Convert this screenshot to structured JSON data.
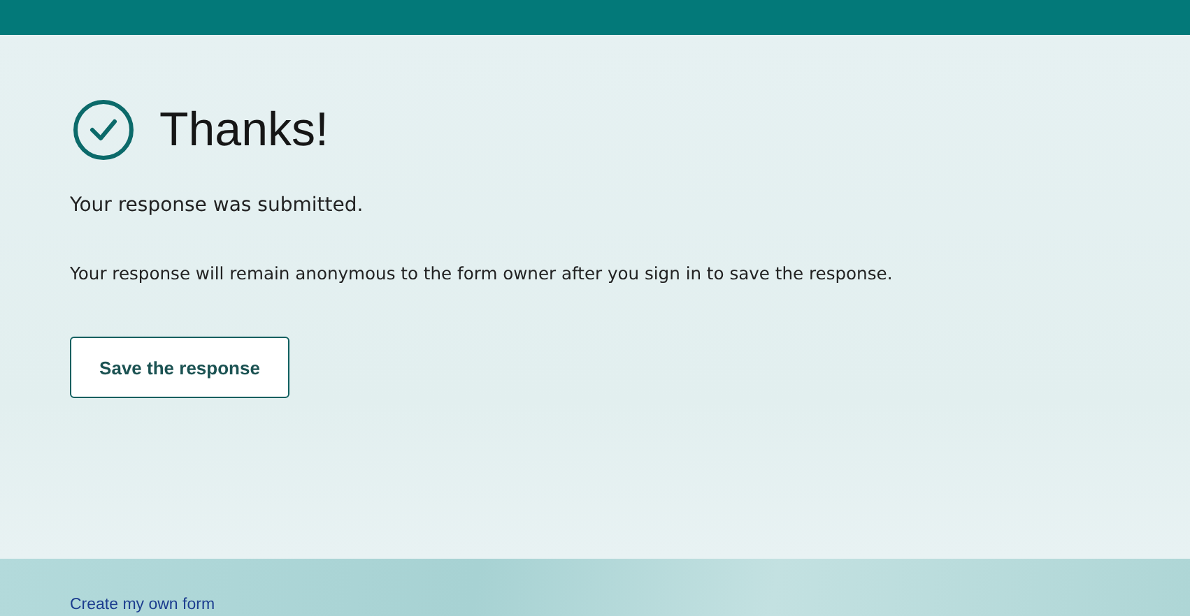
{
  "title": "Thanks!",
  "message": "Your response was submitted.",
  "note": "Your response will remain anonymous to the form owner after you sign in to save the response.",
  "save_button": "Save the response",
  "footer": {
    "link": "Create my own form"
  }
}
